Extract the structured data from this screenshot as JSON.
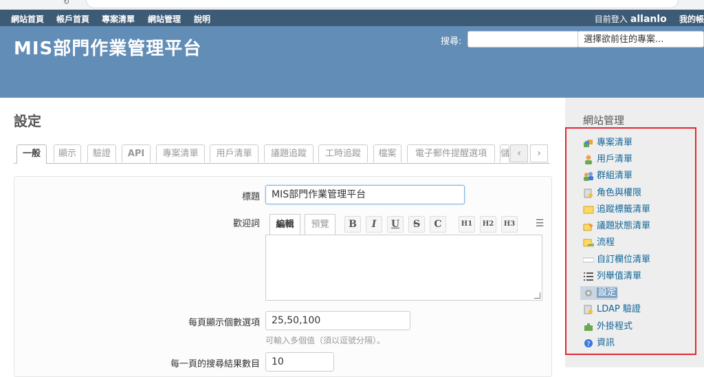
{
  "top_menu": {
    "items": [
      "網站首頁",
      "帳戶首頁",
      "專案清單",
      "網站管理",
      "說明"
    ],
    "login_prefix": "目前登入",
    "username": "allanlo",
    "my_account": "我的帳"
  },
  "header": {
    "title": "MIS部門作業管理平台",
    "search_label": "搜尋:",
    "search_value": "",
    "project_jump": "選擇欲前往的專案..."
  },
  "main": {
    "title": "設定",
    "tabs": [
      "一般",
      "顯示",
      "驗證",
      "API",
      "專案清單",
      "用戶清單",
      "議題追蹤",
      "工時追蹤",
      "檔案",
      "電子郵件提醒選項",
      "儲"
    ],
    "tab_prev": "‹",
    "tab_next": "›",
    "fields": {
      "title_label": "標題",
      "title_value": "MIS部門作業管理平台",
      "welcome_label": "歡迎詞",
      "editor_tab_edit": "編輯",
      "editor_tab_preview": "預覽",
      "toolbar": [
        "B",
        "I",
        "U",
        "S",
        "C",
        "H1",
        "H2",
        "H3",
        "☰"
      ],
      "per_page_label": "每頁顯示個數選項",
      "per_page_value": "25,50,100",
      "per_page_hint": "可輸入多個值（須以逗號分隔）。",
      "search_per_page_label": "每一頁的搜尋結果數目",
      "search_per_page_value": "10"
    }
  },
  "sidebar": {
    "title": "網站管理",
    "items": [
      {
        "label": "專案清單",
        "icon": "projects-icon"
      },
      {
        "label": "用戶清單",
        "icon": "user-icon"
      },
      {
        "label": "群組清單",
        "icon": "group-icon"
      },
      {
        "label": "角色與權限",
        "icon": "roles-icon"
      },
      {
        "label": "追蹤標籤清單",
        "icon": "tracker-icon"
      },
      {
        "label": "議題狀態清單",
        "icon": "issue-status-icon"
      },
      {
        "label": "流程",
        "icon": "workflow-icon"
      },
      {
        "label": "自訂欄位清單",
        "icon": "custom-field-icon"
      },
      {
        "label": "列舉值清單",
        "icon": "list-icon"
      },
      {
        "label": "設定",
        "icon": "gear-icon"
      },
      {
        "label": "LDAP 驗證",
        "icon": "ldap-icon"
      },
      {
        "label": "外掛程式",
        "icon": "plugin-icon"
      },
      {
        "label": "資訊",
        "icon": "info-icon"
      }
    ],
    "selected": "設定"
  },
  "colors": {
    "top_menu_bg": "#3e5b76",
    "header_bg": "#628db6",
    "link": "#116699",
    "sidebar_bg": "#eeeeee",
    "highlight_frame": "#e0262f"
  }
}
